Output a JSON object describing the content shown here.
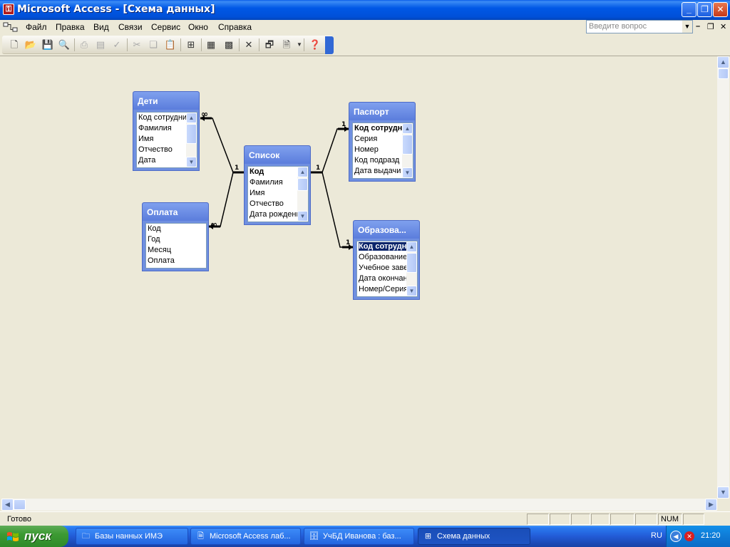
{
  "window": {
    "title": "Microsoft Access - [Схема данных]",
    "min": "_",
    "max": "❐",
    "close": "✕"
  },
  "menu": {
    "items": [
      "Файл",
      "Правка",
      "Вид",
      "Связи",
      "Сервис",
      "Окно",
      "Справка"
    ],
    "ask_placeholder": "Введите вопрос"
  },
  "toolbar": {
    "icons": [
      "new-icon",
      "open-icon",
      "save-icon",
      "print-preview-icon",
      "print-icon",
      "preview-icon",
      "spelling-icon",
      "cut-icon",
      "copy-icon",
      "paste-icon",
      "show-table-icon",
      "show-direct-icon",
      "show-all-icon",
      "delete-icon",
      "properties-icon",
      "new-object-icon",
      "help-icon"
    ]
  },
  "tables": {
    "deti": {
      "title": "Дети",
      "fields": [
        "Код сотрудника",
        "Фамилия",
        "Имя",
        "Отчество",
        "Дата"
      ]
    },
    "spisok": {
      "title": "Список",
      "fields": [
        "Код",
        "Фамилия",
        "Имя",
        "Отчество",
        "Дата рождения"
      ]
    },
    "oplata": {
      "title": "Оплата",
      "fields": [
        "Код",
        "Год",
        "Месяц",
        "Оплата"
      ]
    },
    "pasport": {
      "title": "Паспорт",
      "fields": [
        "Код сотрудника",
        "Серия",
        "Номер",
        "Код подразд",
        "Дата выдачи"
      ]
    },
    "obraz": {
      "title": "Образова...",
      "fields": [
        "Код сотрудника",
        "Образование",
        "Учебное заведение",
        "Дата окончания",
        "Номер/Серия"
      ]
    }
  },
  "relationships": {
    "one": "1",
    "many": "∞"
  },
  "status": {
    "text": "Готово",
    "num": "NUM"
  },
  "taskbar": {
    "start": "пуск",
    "tasks": [
      "Базы нанных ИМЭ",
      "Microsoft Access лаб...",
      "УчБД Иванова : баз...",
      "Схема данных"
    ],
    "lang": "RU",
    "clock": "21:20"
  }
}
